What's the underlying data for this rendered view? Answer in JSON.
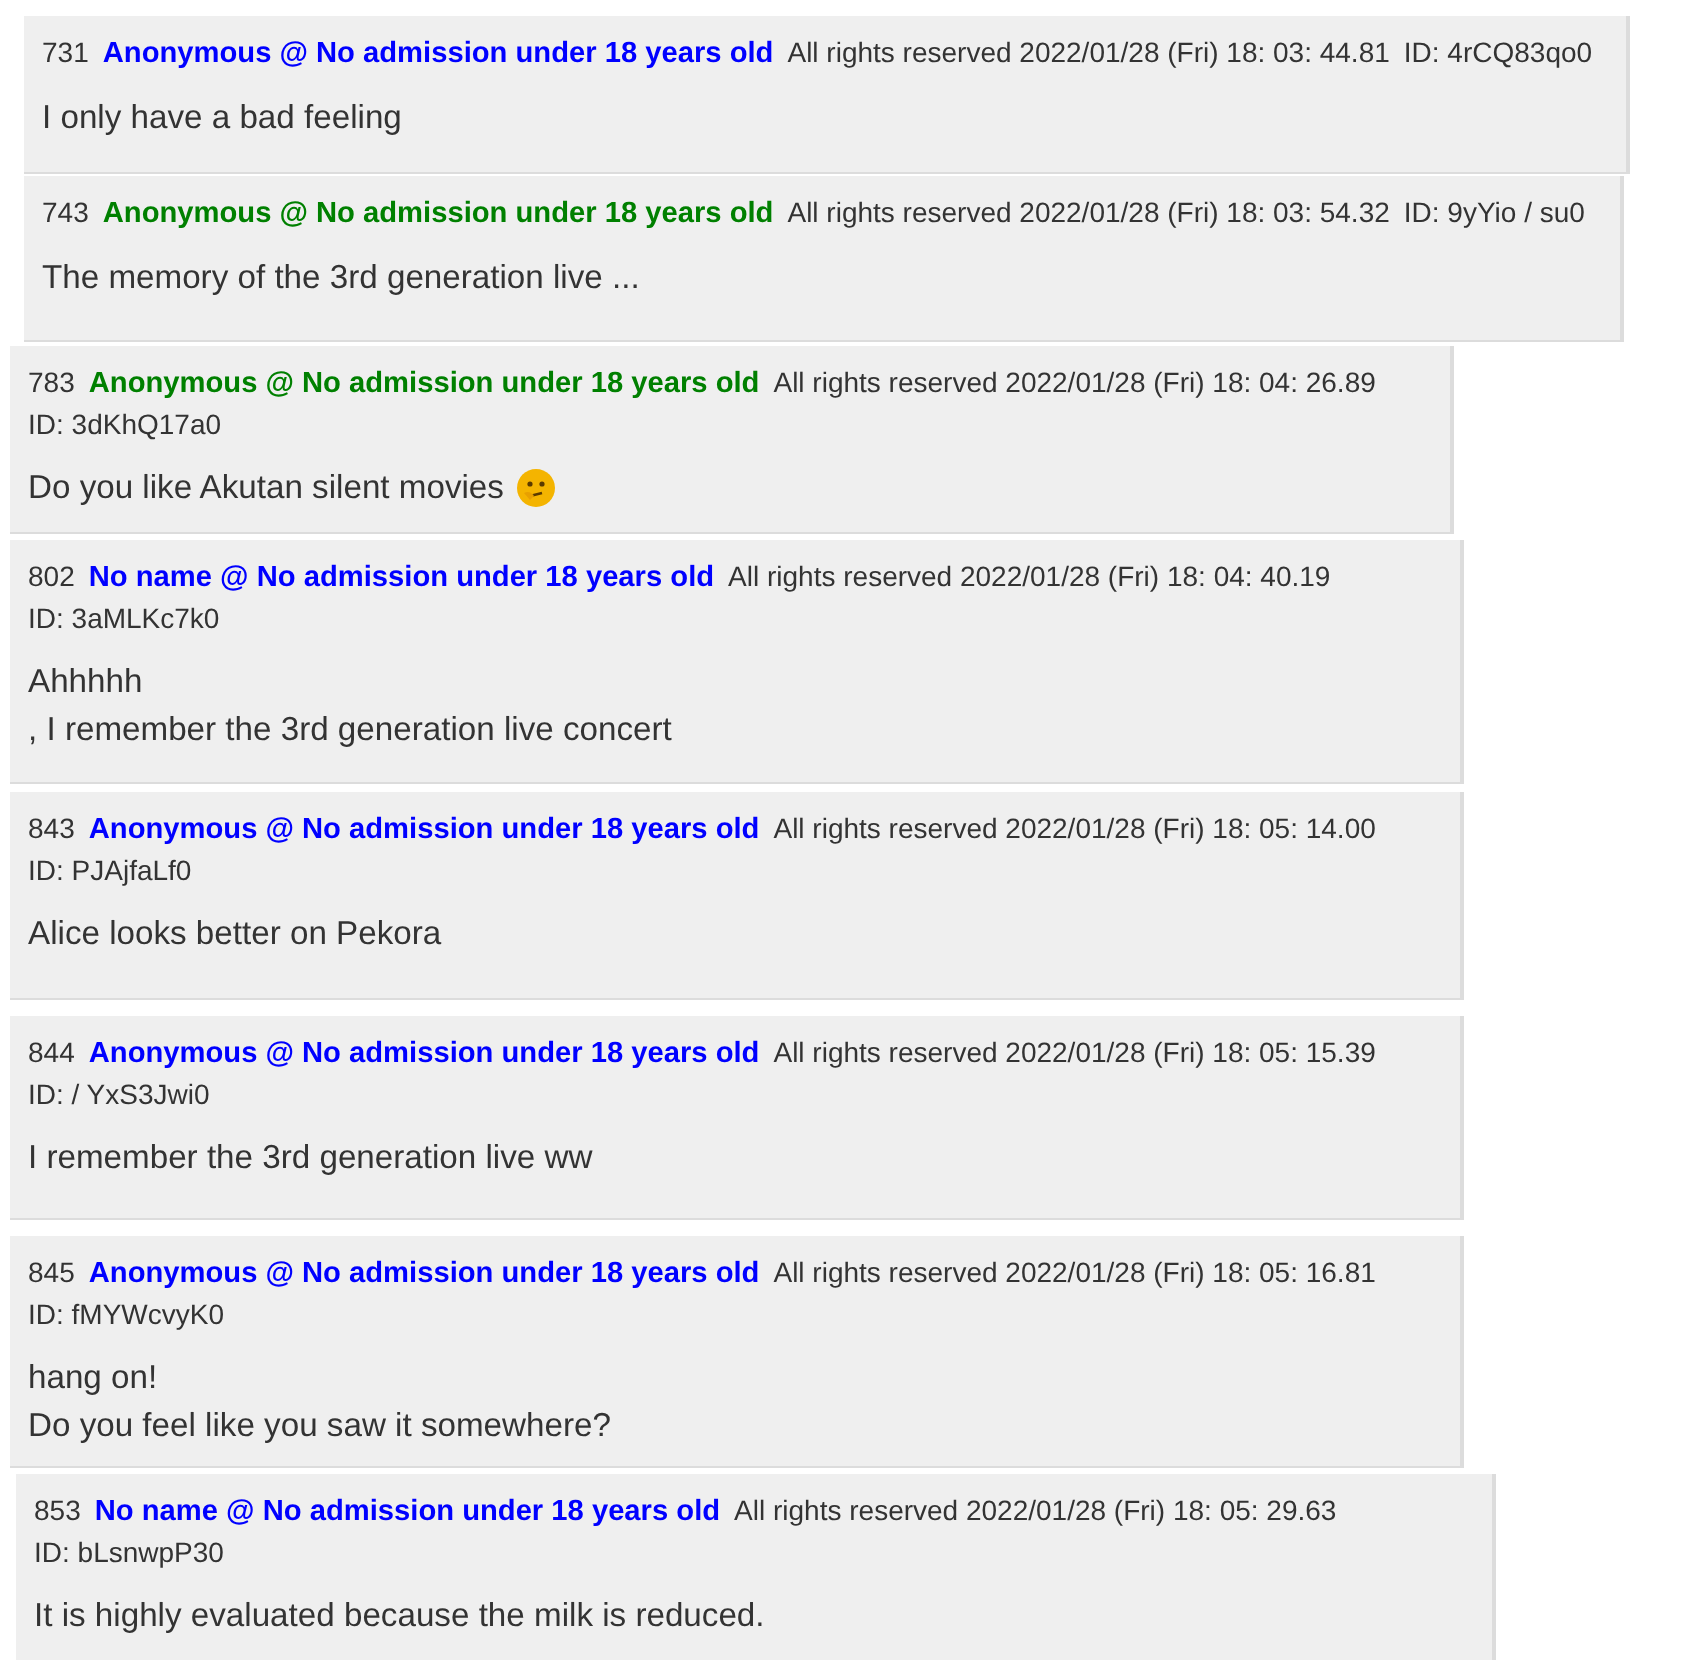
{
  "posts": [
    {
      "number": "731",
      "author": "Anonymous @ No admission under 18 years old",
      "color": "#0000ff",
      "date": "All rights reserved 2022/01/28 (Fri) 18: 03: 44.81",
      "id": "ID: 4rCQ83qo0",
      "lines": [
        "I only have a bad feeling"
      ]
    },
    {
      "number": "743",
      "author": "Anonymous @ No admission under 18 years old",
      "color": "#008000",
      "date": "All rights reserved 2022/01/28 (Fri) 18: 03: 54.32",
      "id": "ID: 9yYio / su0",
      "lines": [
        "The memory of the 3rd generation live ..."
      ]
    },
    {
      "number": "783",
      "author": "Anonymous @ No admission under 18 years old",
      "color": "#008000",
      "date": "All rights reserved 2022/01/28 (Fri) 18: 04: 26.89",
      "id": "ID: 3dKhQ17a0",
      "lines": [
        "Do you like Akutan silent movies"
      ],
      "emoji": true
    },
    {
      "number": "802",
      "author": "No name @ No admission under 18 years old",
      "color": "#0000ff",
      "date": "All rights reserved 2022/01/28 (Fri) 18: 04: 40.19",
      "id": "ID: 3aMLKc7k0",
      "lines": [
        "Ahhhhh",
        ", I remember the 3rd generation live concert"
      ]
    },
    {
      "number": "843",
      "author": "Anonymous @ No admission under 18 years old",
      "color": "#0000ff",
      "date": "All rights reserved 2022/01/28 (Fri) 18: 05: 14.00",
      "id": "ID: PJAjfaLf0",
      "lines": [
        "Alice looks better on Pekora"
      ]
    },
    {
      "number": "844",
      "author": "Anonymous @ No admission under 18 years old",
      "color": "#0000ff",
      "date": "All rights reserved 2022/01/28 (Fri) 18: 05: 15.39",
      "id": "ID: / YxS3Jwi0",
      "lines": [
        "I remember the 3rd generation live ww"
      ]
    },
    {
      "number": "845",
      "author": "Anonymous @ No admission under 18 years old",
      "color": "#0000ff",
      "date": "All rights reserved 2022/01/28 (Fri) 18: 05: 16.81",
      "id": "ID: fMYWcvyK0",
      "lines": [
        "hang on!",
        "Do you feel like you saw it somewhere?"
      ]
    },
    {
      "number": "853",
      "author": "No name @ No admission under 18 years old",
      "color": "#0000ff",
      "date": "All rights reserved 2022/01/28 (Fri) 18: 05: 29.63",
      "id": "ID: bLsnwpP30",
      "lines": [
        "It is highly evaluated because the milk is reduced."
      ]
    }
  ]
}
